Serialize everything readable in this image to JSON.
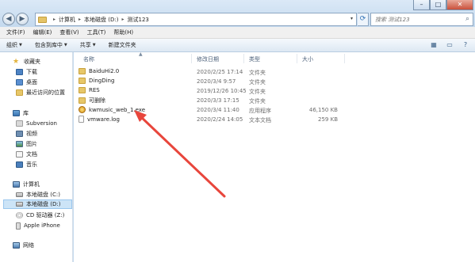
{
  "window": {
    "minimize_glyph": "–",
    "maximize_glyph": "□",
    "close_glyph": "✕"
  },
  "nav": {
    "back_glyph": "◀",
    "forward_glyph": "▶",
    "dropdown_glyph": "▾",
    "refresh_glyph": "⟳"
  },
  "address": {
    "crumbs": [
      "计算机",
      "本地磁盘 (D:)",
      "测试123"
    ],
    "separator": "▸",
    "dropdown_glyph": "▾"
  },
  "search": {
    "placeholder": "搜索 测试123",
    "icon_glyph": "⌕"
  },
  "menubar": {
    "items": [
      "文件(F)",
      "编辑(E)",
      "查看(V)",
      "工具(T)",
      "帮助(H)"
    ]
  },
  "toolbar": {
    "organize": "组织",
    "include_in_library": "包含到库中",
    "share": "共享",
    "new_folder": "新建文件夹",
    "dropdown_glyph": "▼",
    "view_glyph": "▦",
    "preview_glyph": "▭",
    "help_glyph": "?"
  },
  "sidebar": {
    "favorites": "收藏夹",
    "favorites_items": [
      "下载",
      "桌面",
      "最近访问的位置"
    ],
    "libraries": "库",
    "libraries_items": [
      "Subversion",
      "视频",
      "图片",
      "文档",
      "音乐"
    ],
    "computer": "计算机",
    "computer_items": [
      "本地磁盘 (C:)",
      "本地磁盘 (D:)",
      "CD 驱动器 (Z:)",
      "Apple iPhone"
    ],
    "network": "网络",
    "star_glyph": "★"
  },
  "columns": {
    "name": "名称",
    "date": "修改日期",
    "type": "类型",
    "size": "大小",
    "sort_glyph": "▲"
  },
  "files": [
    {
      "name": "BaiduHi2.0",
      "date": "2020/2/25 17:14",
      "type": "文件夹",
      "size": "",
      "icon": "folder-icon"
    },
    {
      "name": "DingDing",
      "date": "2020/3/4 9:57",
      "type": "文件夹",
      "size": "",
      "icon": "folder-icon"
    },
    {
      "name": "RES",
      "date": "2019/12/26 10:45",
      "type": "文件夹",
      "size": "",
      "icon": "folder-icon"
    },
    {
      "name": "可删除",
      "date": "2020/3/3 17:15",
      "type": "文件夹",
      "size": "",
      "icon": "folder-icon"
    },
    {
      "name": "kwmusic_web_1.exe",
      "date": "2020/3/4 11:40",
      "type": "应用程序",
      "size": "46,150 KB",
      "icon": "kwmusic-app-icon"
    },
    {
      "name": "vmware.log",
      "date": "2020/2/24 14:05",
      "type": "文本文档",
      "size": "259 KB",
      "icon": "text-file-icon"
    }
  ],
  "annotation": {
    "color": "#e8463c",
    "target": "kwmusic_web_1.exe"
  },
  "colors": {
    "title_bar": "#c4d9ee",
    "selection": "#cce4f7",
    "close_button": "#c9503b"
  }
}
